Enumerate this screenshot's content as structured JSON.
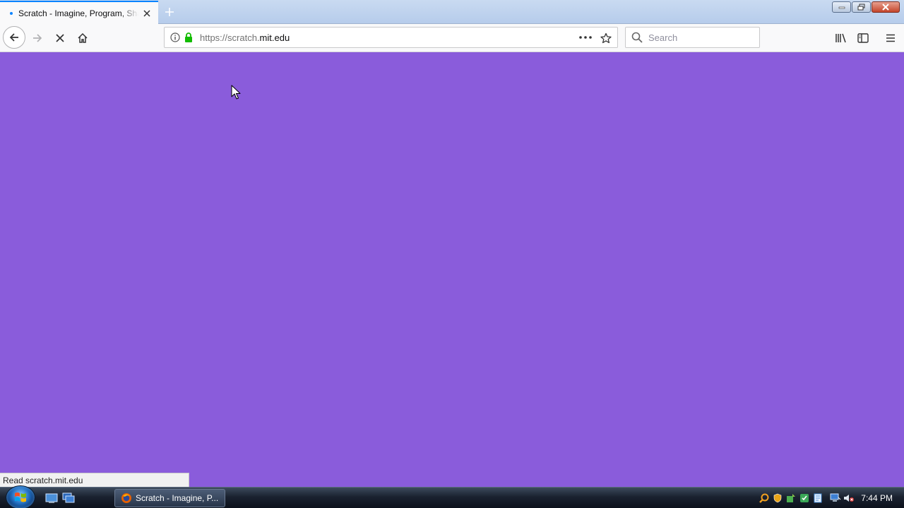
{
  "browser": {
    "tab": {
      "title": "Scratch - Imagine, Program, Share"
    },
    "url": {
      "prefix": "https://scratch.",
      "host": "mit.edu"
    },
    "search": {
      "placeholder": "Search"
    }
  },
  "page": {
    "background_color": "#8a5cdb"
  },
  "status": {
    "text": "Read scratch.mit.edu"
  },
  "taskbar": {
    "task_title": "Scratch - Imagine, P...",
    "clock": "7:44 PM"
  }
}
